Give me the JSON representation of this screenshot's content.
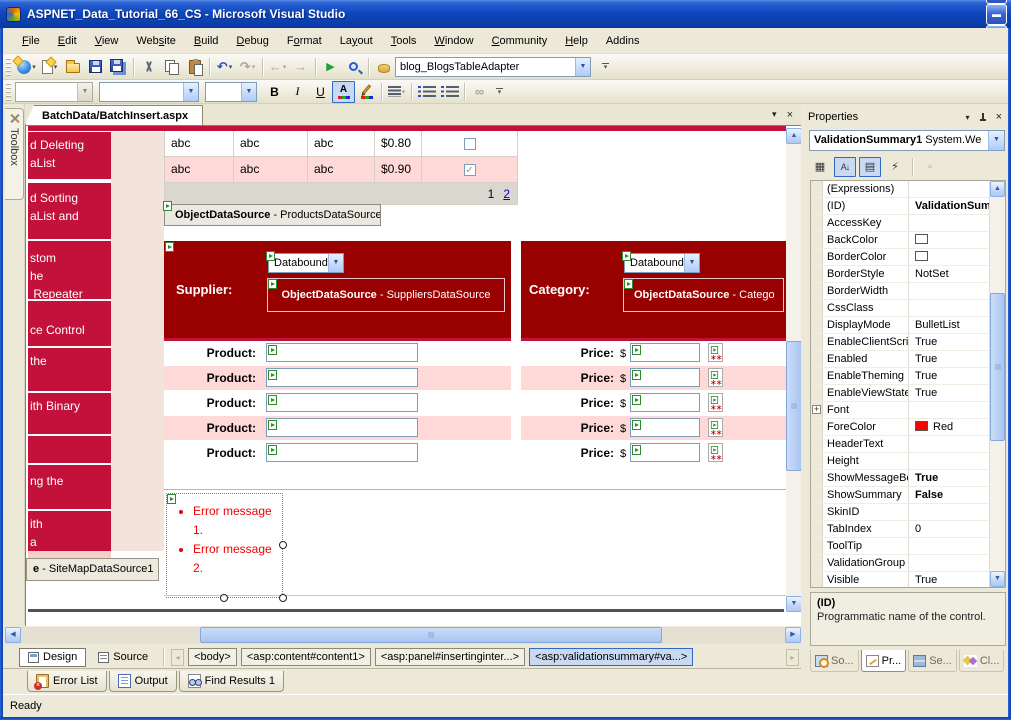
{
  "colors": {
    "titlebar_blue": "#0f47be",
    "accent_red": "#c2123b",
    "header_maroon": "#990000",
    "row_pink": "#ffd8d8",
    "pager_gray": "#dad7ce",
    "error_red": "#ee0000",
    "link_blue": "#0000cc",
    "selection_blue": "#316ac5"
  },
  "window": {
    "title": "ASPNET_Data_Tutorial_66_CS - Microsoft Visual Studio",
    "buttons": [
      {
        "name": "dock-left-right-button",
        "glyph": "◂▸"
      },
      {
        "name": "restore-layout-button",
        "glyph": "❐"
      },
      {
        "name": "minimize-button",
        "glyph": "▬"
      },
      {
        "name": "maximize-button",
        "glyph": "❒"
      },
      {
        "name": "close-button",
        "glyph": "✕",
        "close": true
      }
    ]
  },
  "menubar": {
    "items": [
      {
        "pre": "",
        "key": "F",
        "post": "ile"
      },
      {
        "pre": "",
        "key": "E",
        "post": "dit"
      },
      {
        "pre": "",
        "key": "V",
        "post": "iew"
      },
      {
        "pre": "Web",
        "key": "s",
        "post": "ite"
      },
      {
        "pre": "",
        "key": "B",
        "post": "uild"
      },
      {
        "pre": "",
        "key": "D",
        "post": "ebug"
      },
      {
        "pre": "F",
        "key": "o",
        "post": "rmat"
      },
      {
        "pre": "La",
        "key": "y",
        "post": "out"
      },
      {
        "pre": "",
        "key": "T",
        "post": "ools"
      },
      {
        "pre": "",
        "key": "W",
        "post": "indow"
      },
      {
        "pre": "",
        "key": "C",
        "post": "ommunity"
      },
      {
        "pre": "",
        "key": "H",
        "post": "elp"
      },
      {
        "pre": "Addins",
        "key": "",
        "post": ""
      }
    ]
  },
  "toolbar": {
    "adapter_combo": "blog_BlogsTableAdapter"
  },
  "format_toolbar": {
    "bold": "B",
    "italic": "I",
    "underline": "U",
    "fontcolor": "A",
    "link": "∞"
  },
  "icons": {
    "undo": "↶",
    "redo": "↷",
    "back": "←",
    "forward": "→",
    "play": "▶",
    "dropdown": "▾",
    "title_dropdown": "▾",
    "title_close": "×",
    "tab_close": "✕",
    "up": "▲",
    "down": "▼",
    "left": "◀",
    "right": "▶",
    "nav_left": "◂",
    "nav_right": "▸",
    "categorized": "▦",
    "alphabetical": "A↓",
    "properties_view": "▤",
    "events": "⚡",
    "property_pages": "▫",
    "font_expand": "+",
    "check": "✓"
  },
  "editor": {
    "tab": "BatchData/BatchInsert.aspx",
    "toolbox": "Toolbox"
  },
  "design": {
    "menu_items": [
      {
        "lines": [
          "d Deleting",
          "aList"
        ]
      },
      {
        "lines": [
          "d Sorting",
          "aList and"
        ]
      },
      {
        "lines": [
          "stom",
          "he",
          " Repeater"
        ]
      },
      {
        "lines": [
          "ce Control"
        ]
      },
      {
        "lines": [
          "the"
        ]
      },
      {
        "lines": [
          "ith Binary"
        ]
      },
      {
        "lines": []
      },
      {
        "lines": [
          "ng the"
        ]
      },
      {
        "lines": [
          "ith",
          "a"
        ]
      }
    ],
    "gridview": {
      "rows": [
        {
          "cells": [
            "abc",
            "abc",
            "abc",
            "$0.80"
          ],
          "checked": false,
          "alt": false
        },
        {
          "cells": [
            "abc",
            "abc",
            "abc",
            "$0.90"
          ],
          "checked": true,
          "alt": true
        }
      ],
      "pager": {
        "current": "1",
        "link": "2"
      }
    },
    "products_ds": {
      "bold": "ObjectDataSource",
      "rest": " - ProductsDataSource"
    },
    "header": {
      "supplier_label": "Supplier:",
      "category_label": "Category:",
      "supplier_dropdown": "Databound",
      "category_dropdown": "Databound",
      "suppliers_ds": {
        "bold": "ObjectDataSource",
        "rest": " - SuppliersDataSource"
      },
      "categories_ds": {
        "bold": "ObjectDataSource",
        "rest": " - Catego"
      }
    },
    "insert_rows": {
      "count": 5,
      "product_label": "Product:",
      "price_label": "Price:",
      "currency": "$"
    },
    "validation_summary": {
      "items": [
        "Error message 1.",
        "Error message 2."
      ]
    },
    "sitemap_ds": {
      "bold": "e",
      "rest": " - SiteMapDataSource1"
    }
  },
  "viewbar": {
    "design": "Design",
    "source": "Source",
    "tags": [
      {
        "label": "<body>",
        "selected": false
      },
      {
        "label": "<asp:content#content1>",
        "selected": false
      },
      {
        "label": "<asp:panel#insertinginter...>",
        "selected": false
      },
      {
        "label": "<asp:validationsummary#va...>",
        "selected": true
      }
    ]
  },
  "bottom_tabs": [
    {
      "label": "Error List",
      "icon": "error-list-icon"
    },
    {
      "label": "Output",
      "icon": "output-icon"
    },
    {
      "label": "Find Results 1",
      "icon": "find-results-icon"
    }
  ],
  "statusbar": {
    "text": "Ready"
  },
  "properties": {
    "title": "Properties",
    "object": {
      "name": "ValidationSummary1",
      "type": " System.We"
    },
    "rows": [
      {
        "name": "(Expressions)",
        "value": ""
      },
      {
        "name": "(ID)",
        "value": "ValidationSum",
        "value_bold": true
      },
      {
        "name": "AccessKey",
        "value": ""
      },
      {
        "name": "BackColor",
        "value": "",
        "swatch": "#ffffff"
      },
      {
        "name": "BorderColor",
        "value": "",
        "swatch": "#ffffff"
      },
      {
        "name": "BorderStyle",
        "value": "NotSet"
      },
      {
        "name": "BorderWidth",
        "value": ""
      },
      {
        "name": "CssClass",
        "value": ""
      },
      {
        "name": "DisplayMode",
        "value": "BulletList"
      },
      {
        "name": "EnableClientScri",
        "value": "True"
      },
      {
        "name": "Enabled",
        "value": "True"
      },
      {
        "name": "EnableTheming",
        "value": "True"
      },
      {
        "name": "EnableViewState",
        "value": "True"
      },
      {
        "name": "Font",
        "value": "",
        "expand": true
      },
      {
        "name": "ForeColor",
        "value": "Red",
        "swatch": "#ff0000"
      },
      {
        "name": "HeaderText",
        "value": ""
      },
      {
        "name": "Height",
        "value": ""
      },
      {
        "name": "ShowMessageBo",
        "value": "True",
        "value_bold": true
      },
      {
        "name": "ShowSummary",
        "value": "False",
        "value_bold": true
      },
      {
        "name": "SkinID",
        "value": ""
      },
      {
        "name": "TabIndex",
        "value": "0"
      },
      {
        "name": "ToolTip",
        "value": ""
      },
      {
        "name": "ValidationGroup",
        "value": ""
      },
      {
        "name": "Visible",
        "value": "True"
      }
    ],
    "description": {
      "title": "(ID)",
      "text": "Programmatic name of the control."
    },
    "tabs": [
      {
        "label": "So...",
        "icon": "solution-explorer-icon",
        "active": false
      },
      {
        "label": "Pr...",
        "icon": "properties-icon",
        "active": true
      },
      {
        "label": "Se...",
        "icon": "server-explorer-icon",
        "active": false
      },
      {
        "label": "Cl...",
        "icon": "class-view-icon",
        "active": false
      }
    ]
  }
}
